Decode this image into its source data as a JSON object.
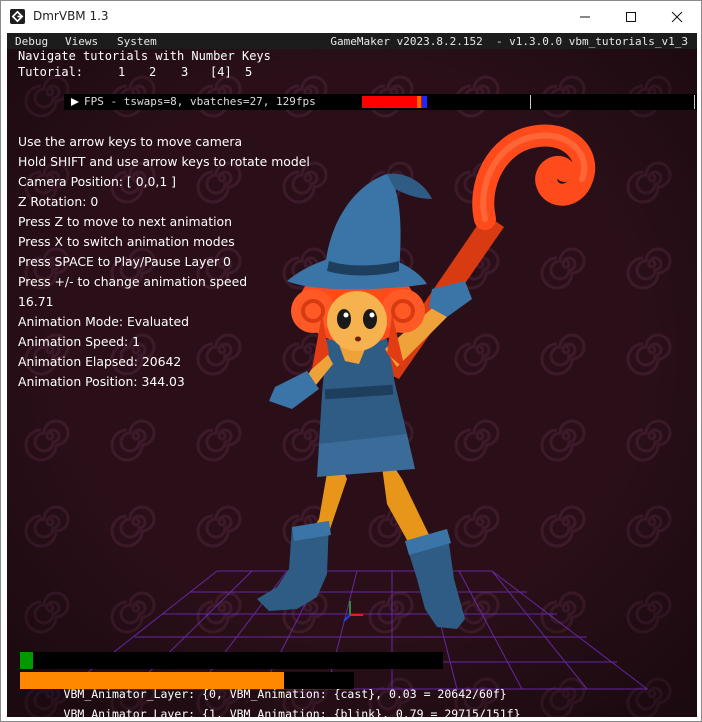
{
  "window": {
    "title": "DmrVBM 1.3"
  },
  "menubar": {
    "items": [
      "Debug",
      "Views",
      "System"
    ],
    "right_text": "GameMaker v2023.8.2.152  - v1.3.0.0 vbm_tutorials_v1_3"
  },
  "hud": {
    "navigate": "Navigate tutorials with Number Keys",
    "tutorial_label": "Tutorial:",
    "tutorials": [
      "1",
      "2",
      "3",
      "[4]",
      "5"
    ]
  },
  "fps": {
    "text": "FPS - tswaps=8, vbatches=27, 129fps",
    "bar_colors": [
      "#ff0000",
      "#ff6a00",
      "#1a2aff"
    ]
  },
  "info_lines": [
    "Use the arrow keys to move camera",
    "Hold SHIFT and use arrow keys to rotate model",
    "Camera Position: [ 0,0,1 ]",
    "Z Rotation: 0",
    "Press Z to move to next animation",
    "Press X to switch animation modes",
    "Press SPACE to Play/Pause Layer 0",
    "Press +/- to change animation speed",
    "16.71",
    "Animation Mode: Evaluated",
    "Animation Speed: 1",
    "Animation Elapsed: 20642",
    "Animation Position: 344.03"
  ],
  "layers": [
    {
      "text": "VBM_Animator_Layer: {0, VBM_Animation: {cast}, 0.03 = 20642/60f}",
      "progress": 0.03,
      "color": "#009900"
    },
    {
      "text": "VBM_Animator_Layer: {1, VBM_Animation: {blink}, 0.79 = 29715/151f}",
      "progress": 0.79,
      "color": "#ff8800"
    }
  ],
  "colors": {
    "background": "#2a0f18",
    "swirl": "#3d1a2a",
    "floor_grid": "#7a2fd0"
  }
}
